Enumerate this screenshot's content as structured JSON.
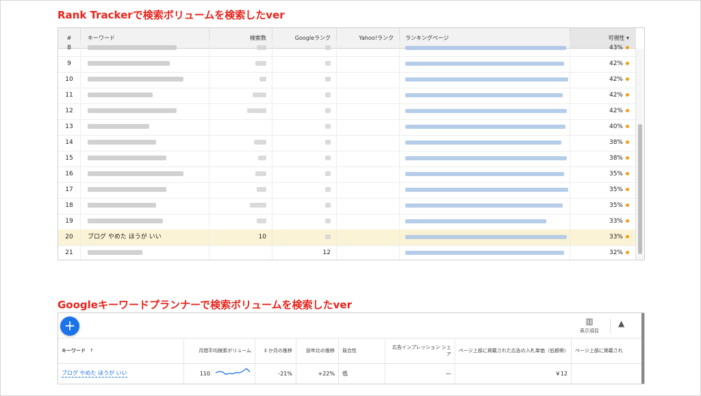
{
  "headings": {
    "rank_tracker": "Rank Trackerで検索ボリュームを検索したver",
    "keyword_planner": "Googleキーワードプランナーで検索ボリュームを検索したver"
  },
  "rank_tracker": {
    "columns": {
      "num": "#",
      "keyword": "キーワード",
      "volume": "検索数",
      "google_rank": "Googleランク",
      "yahoo_rank": "Yahoo!ランク",
      "ranking_page": "ランキングページ",
      "visibility": "可視性"
    },
    "sort_indicator": "▾",
    "rows": [
      {
        "num": "8",
        "visibility": "43%"
      },
      {
        "num": "9",
        "visibility": "42%"
      },
      {
        "num": "10",
        "visibility": "42%"
      },
      {
        "num": "11",
        "visibility": "42%"
      },
      {
        "num": "12",
        "visibility": "42%"
      },
      {
        "num": "13",
        "visibility": "40%"
      },
      {
        "num": "14",
        "visibility": "38%"
      },
      {
        "num": "15",
        "visibility": "38%"
      },
      {
        "num": "16",
        "visibility": "35%"
      },
      {
        "num": "17",
        "visibility": "35%"
      },
      {
        "num": "18",
        "visibility": "35%"
      },
      {
        "num": "19",
        "visibility": "33%"
      },
      {
        "num": "20",
        "keyword": "ブログ やめた ほうが いい",
        "volume": "10",
        "visibility": "33%",
        "highlighted": true
      },
      {
        "num": "21",
        "google_rank": "12",
        "visibility": "32%"
      }
    ],
    "dot_color": "#f39c12"
  },
  "keyword_planner": {
    "add_button": "+",
    "columns_button_label": "表示項目",
    "columns": {
      "keyword": "キーワード",
      "keyword_sort": "↑",
      "avg_monthly": "月間平均検索ボリューム",
      "three_month": "3 か月の推移",
      "yoy": "前年比の推移",
      "competition": "競合性",
      "impression_share": "広告インプレッション シェア",
      "top_bid_low": "ページ上部に掲載された広告の入札単価（低額帯）",
      "top_bid_high": "ページ上部に掲載され"
    },
    "row": {
      "keyword": "ブログ やめた ほうが いい",
      "avg_monthly": "110",
      "sparkline": [
        0.55,
        0.7,
        0.65,
        0.4,
        0.5,
        0.45,
        0.6,
        0.55,
        0.75,
        1.0,
        0.65
      ],
      "three_month": "-21%",
      "yoy": "+22%",
      "competition": "低",
      "impression_share": "—",
      "top_bid_low": "￥12"
    },
    "accent_color": "#1a73e8"
  }
}
